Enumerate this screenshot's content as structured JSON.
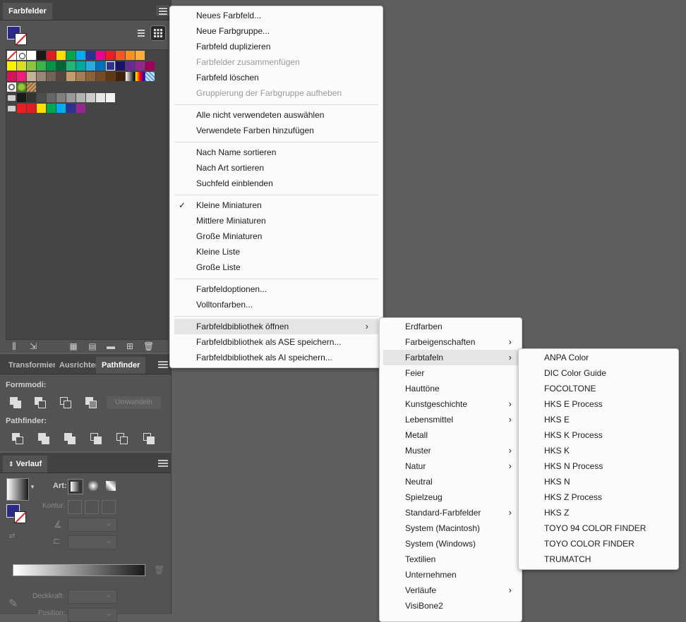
{
  "swatches_panel": {
    "tab": "Farbfelder",
    "fill_color": "#2a2a8a",
    "rows": [
      [
        "none",
        "#ffffff|reg",
        "#ffffff",
        "#1a1a1a",
        "#e31b23",
        "#ffde00",
        "#00a650",
        "#00aeef",
        "#2e3192",
        "#ec008c",
        "#ed1c24",
        "#f15a24",
        "#f7931e",
        "#fbb03b"
      ],
      [
        "#fff200",
        "#d9e021",
        "#8cc63f",
        "#39b54a",
        "#009245",
        "#006837",
        "#22b573",
        "#00a99d",
        "#29abe2",
        "#0071bc",
        "#2e3192|sel",
        "#1b1464",
        "#662d91",
        "#93278f",
        "#9e005d"
      ],
      [
        "#d4145a",
        "#ed1e79",
        "#c7b299",
        "#998675",
        "#736357",
        "#534741",
        "#c69c6d",
        "#a67c52",
        "#8c6239",
        "#754c24",
        "#603813",
        "#42210b",
        "#gradient-bw",
        "#gradient-rainbow",
        "#pattern-blue"
      ],
      [
        "#pattern-circles",
        "#pattern-leaf",
        "#pattern-texture"
      ],
      [
        "folder",
        "#1a1a1a",
        "#333333",
        "#4d4d4d",
        "#666666",
        "#808080",
        "#999999",
        "#b3b3b3",
        "#cccccc",
        "#e6e6e6",
        "#f2f2f2"
      ],
      [
        "folder",
        "#ed1c24",
        "#e31b23",
        "#ffde00",
        "#00a650",
        "#00aeef",
        "#2e3192",
        "#93278f"
      ]
    ]
  },
  "pathfinder_panel": {
    "tabs": [
      "Transformieren",
      "Ausrichten",
      "Pathfinder"
    ],
    "formmodi_label": "Formmodi:",
    "umwandeln_label": "Umwandeln",
    "pathfinder_label": "Pathfinder:"
  },
  "verlauf_panel": {
    "tab": "Verlauf",
    "art_label": "Art:",
    "kontur_label": "Kontur:",
    "deckkraft_label": "Deckkraft:",
    "position_label": "Position:"
  },
  "main_menu": {
    "items": [
      {
        "label": "Neues Farbfeld...",
        "state": "enabled"
      },
      {
        "label": "Neue Farbgruppe...",
        "state": "enabled"
      },
      {
        "label": "Farbfeld duplizieren",
        "state": "enabled"
      },
      {
        "label": "Farbfelder zusammenfügen",
        "state": "disabled"
      },
      {
        "label": "Farbfeld löschen",
        "state": "enabled"
      },
      {
        "label": "Gruppierung der Farbgruppe aufheben",
        "state": "disabled"
      },
      {
        "label": "Alle nicht verwendeten auswählen",
        "state": "enabled"
      },
      {
        "label": "Verwendete Farben hinzufügen",
        "state": "enabled"
      },
      {
        "label": "Nach Name sortieren",
        "state": "enabled"
      },
      {
        "label": "Nach Art sortieren",
        "state": "enabled"
      },
      {
        "label": "Suchfeld einblenden",
        "state": "enabled"
      },
      {
        "label": "Kleine Miniaturen",
        "state": "checked"
      },
      {
        "label": "Mittlere Miniaturen",
        "state": "enabled"
      },
      {
        "label": "Große Miniaturen",
        "state": "enabled"
      },
      {
        "label": "Kleine Liste",
        "state": "enabled"
      },
      {
        "label": "Große Liste",
        "state": "enabled"
      },
      {
        "label": "Farbfeldoptionen...",
        "state": "enabled"
      },
      {
        "label": "Volltonfarben...",
        "state": "enabled"
      },
      {
        "label": "Farbfeldbibliothek öffnen",
        "state": "highlighted-submenu"
      },
      {
        "label": "Farbfeldbibliothek als ASE speichern...",
        "state": "enabled"
      },
      {
        "label": "Farbfeldbibliothek als AI speichern...",
        "state": "enabled"
      }
    ]
  },
  "library_menu": {
    "items": [
      {
        "label": "Erdfarben",
        "submenu": false
      },
      {
        "label": "Farbeigenschaften",
        "submenu": true
      },
      {
        "label": "Farbtafeln",
        "submenu": true,
        "highlighted": true
      },
      {
        "label": "Feier",
        "submenu": false
      },
      {
        "label": "Hauttöne",
        "submenu": false
      },
      {
        "label": "Kunstgeschichte",
        "submenu": true
      },
      {
        "label": "Lebensmittel",
        "submenu": true
      },
      {
        "label": "Metall",
        "submenu": false
      },
      {
        "label": "Muster",
        "submenu": true
      },
      {
        "label": "Natur",
        "submenu": true
      },
      {
        "label": "Neutral",
        "submenu": false
      },
      {
        "label": "Spielzeug",
        "submenu": false
      },
      {
        "label": "Standard-Farbfelder",
        "submenu": true
      },
      {
        "label": "System (Macintosh)",
        "submenu": false
      },
      {
        "label": "System (Windows)",
        "submenu": false
      },
      {
        "label": "Textilien",
        "submenu": false
      },
      {
        "label": "Unternehmen",
        "submenu": false
      },
      {
        "label": "Verläufe",
        "submenu": true
      },
      {
        "label": "VisiBone2",
        "submenu": false
      }
    ]
  },
  "farbtafeln_menu": {
    "items": [
      "ANPA Color",
      "DIC Color Guide",
      "FOCOLTONE",
      "HKS E Process",
      "HKS E",
      "HKS K Process",
      "HKS K",
      "HKS N Process",
      "HKS N",
      "HKS Z Process",
      "HKS Z",
      "TOYO 94 COLOR FINDER",
      "TOYO COLOR FINDER",
      "TRUMATCH"
    ]
  }
}
